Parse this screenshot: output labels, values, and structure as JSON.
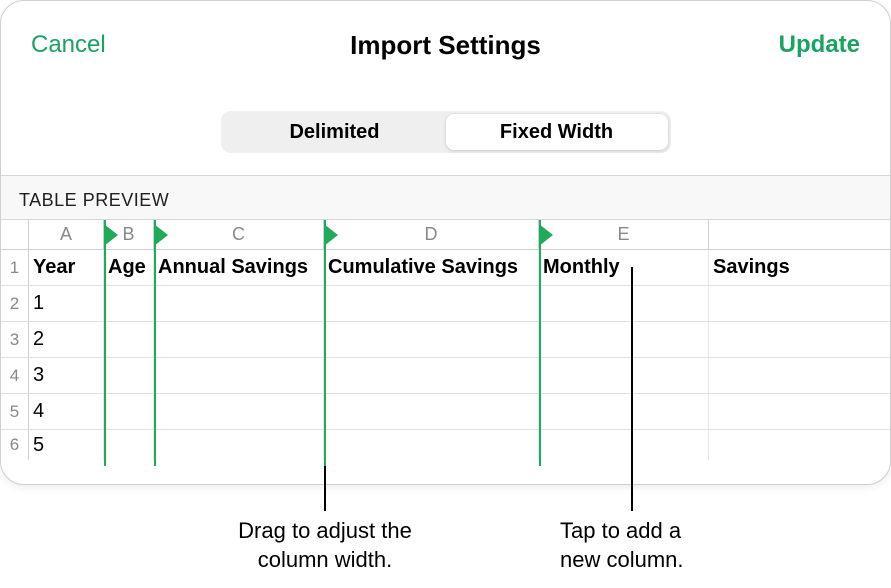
{
  "header": {
    "cancel": "Cancel",
    "title": "Import Settings",
    "update": "Update"
  },
  "segmented": {
    "delimited": "Delimited",
    "fixedwidth": "Fixed Width"
  },
  "preview_label": "TABLE PREVIEW",
  "columns": [
    "A",
    "B",
    "C",
    "D",
    "E"
  ],
  "header_row": {
    "A": "Year",
    "B": "Age",
    "C": "Annual Savings",
    "D": "Cumulative Savings",
    "E": "Monthly",
    "rest": "Savings"
  },
  "rows": [
    {
      "num": "1"
    },
    {
      "num": "2",
      "A": "1"
    },
    {
      "num": "3",
      "A": "2"
    },
    {
      "num": "4",
      "A": "3"
    },
    {
      "num": "5",
      "A": "4"
    },
    {
      "num": "6",
      "A": "5"
    }
  ],
  "callouts": {
    "drag": "Drag to adjust the\ncolumn width.",
    "tap": "Tap to add a\nnew column."
  }
}
